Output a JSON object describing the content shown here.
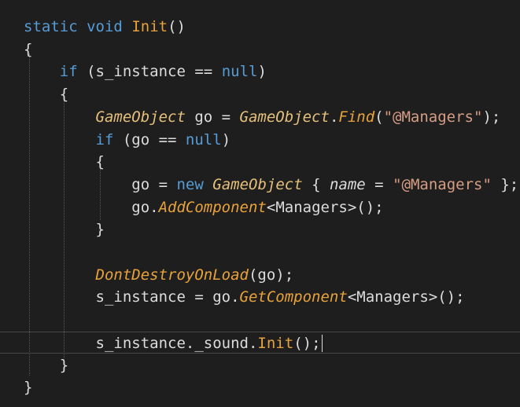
{
  "editor": {
    "lines": [
      [
        {
          "t": "static",
          "c": "kw"
        },
        {
          "t": " ",
          "c": "plain"
        },
        {
          "t": "void",
          "c": "kw"
        },
        {
          "t": " ",
          "c": "plain"
        },
        {
          "t": "Init",
          "c": "fn"
        },
        {
          "t": "()",
          "c": "plain"
        }
      ],
      [
        {
          "t": "{",
          "c": "plain"
        }
      ],
      [
        {
          "t": "    ",
          "c": "plain"
        },
        {
          "t": "if",
          "c": "kw"
        },
        {
          "t": " (s_instance == ",
          "c": "plain"
        },
        {
          "t": "null",
          "c": "kw"
        },
        {
          "t": ")",
          "c": "plain"
        }
      ],
      [
        {
          "t": "    {",
          "c": "plain"
        }
      ],
      [
        {
          "t": "        ",
          "c": "plain"
        },
        {
          "t": "GameObject",
          "c": "type"
        },
        {
          "t": " go = ",
          "c": "plain"
        },
        {
          "t": "GameObject",
          "c": "type"
        },
        {
          "t": ".",
          "c": "plain"
        },
        {
          "t": "Find",
          "c": "method"
        },
        {
          "t": "(",
          "c": "plain"
        },
        {
          "t": "\"@Managers\"",
          "c": "str"
        },
        {
          "t": ");",
          "c": "plain"
        }
      ],
      [
        {
          "t": "        ",
          "c": "plain"
        },
        {
          "t": "if",
          "c": "kw"
        },
        {
          "t": " (go == ",
          "c": "plain"
        },
        {
          "t": "null",
          "c": "kw"
        },
        {
          "t": ")",
          "c": "plain"
        }
      ],
      [
        {
          "t": "        {",
          "c": "plain"
        }
      ],
      [
        {
          "t": "            go = ",
          "c": "plain"
        },
        {
          "t": "new",
          "c": "kw"
        },
        {
          "t": " ",
          "c": "plain"
        },
        {
          "t": "GameObject",
          "c": "type"
        },
        {
          "t": " { ",
          "c": "plain"
        },
        {
          "t": "name",
          "c": "prop"
        },
        {
          "t": " = ",
          "c": "plain"
        },
        {
          "t": "\"@Managers\"",
          "c": "str"
        },
        {
          "t": " };",
          "c": "plain"
        }
      ],
      [
        {
          "t": "            go.",
          "c": "plain"
        },
        {
          "t": "AddComponent",
          "c": "method"
        },
        {
          "t": "<Managers>();",
          "c": "plain"
        }
      ],
      [
        {
          "t": "        }",
          "c": "plain"
        }
      ],
      [],
      [
        {
          "t": "        ",
          "c": "plain"
        },
        {
          "t": "DontDestroyOnLoad",
          "c": "method"
        },
        {
          "t": "(go);",
          "c": "plain"
        }
      ],
      [
        {
          "t": "        s_instance = go.",
          "c": "plain"
        },
        {
          "t": "GetComponent",
          "c": "method"
        },
        {
          "t": "<Managers>();",
          "c": "plain"
        }
      ],
      [],
      [
        {
          "t": "        s_instance._sound.",
          "c": "plain"
        },
        {
          "t": "Init",
          "c": "fn"
        },
        {
          "t": "();",
          "c": "plain"
        }
      ],
      [
        {
          "t": "    }",
          "c": "plain"
        }
      ],
      [
        {
          "t": "}",
          "c": "plain"
        }
      ]
    ],
    "current_line": 14
  }
}
